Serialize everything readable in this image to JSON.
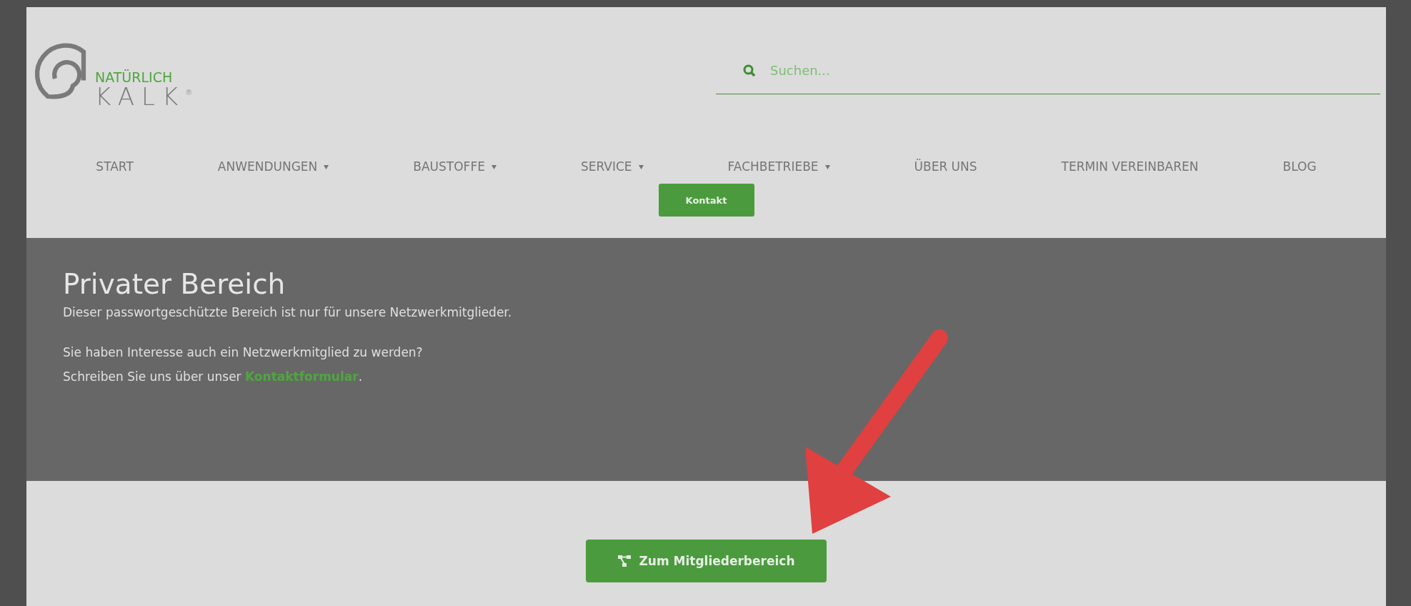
{
  "logo": {
    "tagline": "NATÜRLICH",
    "name": "KALK",
    "mark": "®"
  },
  "search": {
    "placeholder": "Suchen..."
  },
  "nav": [
    {
      "label": "START",
      "dropdown": false
    },
    {
      "label": "ANWENDUNGEN",
      "dropdown": true
    },
    {
      "label": "BAUSTOFFE",
      "dropdown": true
    },
    {
      "label": "SERVICE",
      "dropdown": true
    },
    {
      "label": "FACHBETRIEBE",
      "dropdown": true
    },
    {
      "label": "ÜBER UNS",
      "dropdown": false
    },
    {
      "label": "TERMIN VEREINBAREN",
      "dropdown": false
    },
    {
      "label": "BLOG",
      "dropdown": false
    }
  ],
  "nav_button": "Kontakt",
  "banner": {
    "title": "Privater Bereich",
    "intro": "Dieser passwortgeschützte Bereich ist nur für unsere Netzwerkmitglieder.",
    "question": "Sie haben Interesse auch ein Netzwerkmitglied zu werden?",
    "contact_before": "Schreiben Sie uns über unser ",
    "contact_link": "Kontaktformular",
    "contact_after": "."
  },
  "member_button": "Zum Mitgliederbereich"
}
